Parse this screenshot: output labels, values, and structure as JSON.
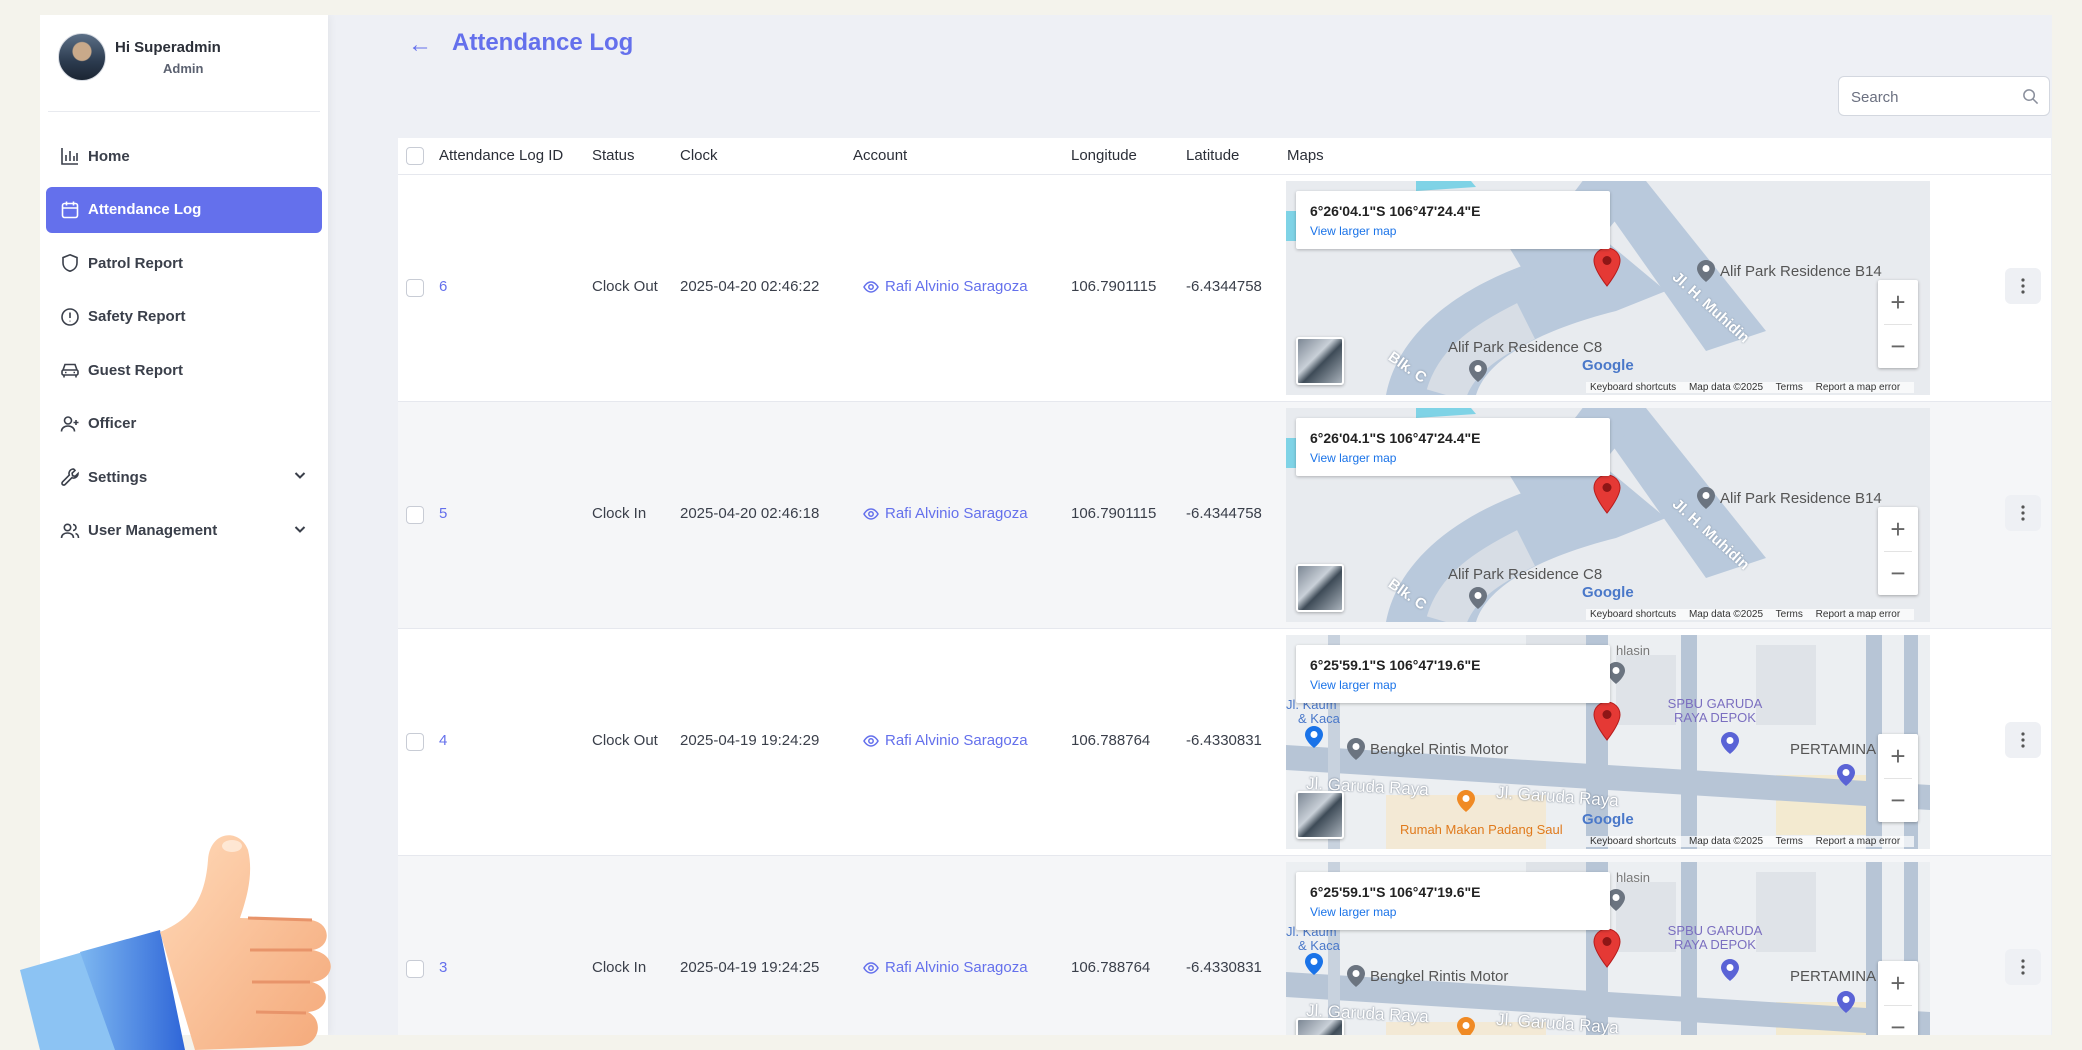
{
  "sidebar": {
    "profile": {
      "name": "Hi Superadmin",
      "role": "Admin"
    },
    "items": [
      {
        "label": "Home",
        "icon": "bar-chart-icon",
        "active": false
      },
      {
        "label": "Attendance Log",
        "icon": "calendar-icon",
        "active": true
      },
      {
        "label": "Patrol Report",
        "icon": "shield-icon",
        "active": false
      },
      {
        "label": "Safety Report",
        "icon": "alert-circle-icon",
        "active": false
      },
      {
        "label": "Guest Report",
        "icon": "car-icon",
        "active": false
      },
      {
        "label": "Officer",
        "icon": "user-plus-icon",
        "active": false
      },
      {
        "label": "Settings",
        "icon": "wrench-icon",
        "active": false,
        "expandable": true
      },
      {
        "label": "User Management",
        "icon": "users-icon",
        "active": false,
        "expandable": true
      }
    ]
  },
  "header": {
    "title": "Attendance Log"
  },
  "search": {
    "placeholder": "Search"
  },
  "table": {
    "columns": [
      "Attendance Log ID",
      "Status",
      "Clock",
      "Account",
      "Longitude",
      "Latitude",
      "Maps"
    ],
    "rows": [
      {
        "id": "6",
        "status": "Clock Out",
        "clock": "2025-04-20 02:46:22",
        "account": "Rafi Alvinio Saragoza",
        "longitude": "106.7901115",
        "latitude": "-6.4344758",
        "coords": "6°26'04.1\"S 106°47'24.4\"E",
        "map": "residence"
      },
      {
        "id": "5",
        "status": "Clock In",
        "clock": "2025-04-20 02:46:18",
        "account": "Rafi Alvinio Saragoza",
        "longitude": "106.7901115",
        "latitude": "-6.4344758",
        "coords": "6°26'04.1\"S 106°47'24.4\"E",
        "map": "residence"
      },
      {
        "id": "4",
        "status": "Clock Out",
        "clock": "2025-04-19 19:24:29",
        "account": "Rafi Alvinio Saragoza",
        "longitude": "106.788764",
        "latitude": "-6.4330831",
        "coords": "6°25'59.1\"S 106°47'19.6\"E",
        "map": "garuda"
      },
      {
        "id": "3",
        "status": "Clock In",
        "clock": "2025-04-19 19:24:25",
        "account": "Rafi Alvinio Saragoza",
        "longitude": "106.788764",
        "latitude": "-6.4330831",
        "coords": "6°25'59.1\"S 106°47'19.6\"E",
        "map": "garuda"
      }
    ]
  },
  "map": {
    "view_larger": "View larger map",
    "google": "Google",
    "attribution": [
      "Keyboard shortcuts",
      "Map data ©2025",
      "Terms",
      "Report a map error"
    ],
    "residence_labels": {
      "place_1": "Alif Park Residence B14",
      "place_2": "Alif Park Residence C8",
      "road_1": "Jl. H. Muhidin",
      "road_2": "Blk. C"
    },
    "garuda_labels": {
      "place_1": "Bengkel Rintis Motor",
      "place_2": "SPBU GARUDA RAYA DEPOK",
      "place_3": "PERTAMINA",
      "road_1": "Jl. Garuda Raya",
      "road_2": "Jl. Garuda Raya",
      "place_4": "Rumah Makan Padang Saul",
      "place_5": "& Kaca",
      "place_6": "hlasin",
      "place_7": "Jl. Kaum"
    }
  },
  "colors": {
    "accent": "#6470ec",
    "pin": "#e53935",
    "road": "#b8c8dc"
  }
}
